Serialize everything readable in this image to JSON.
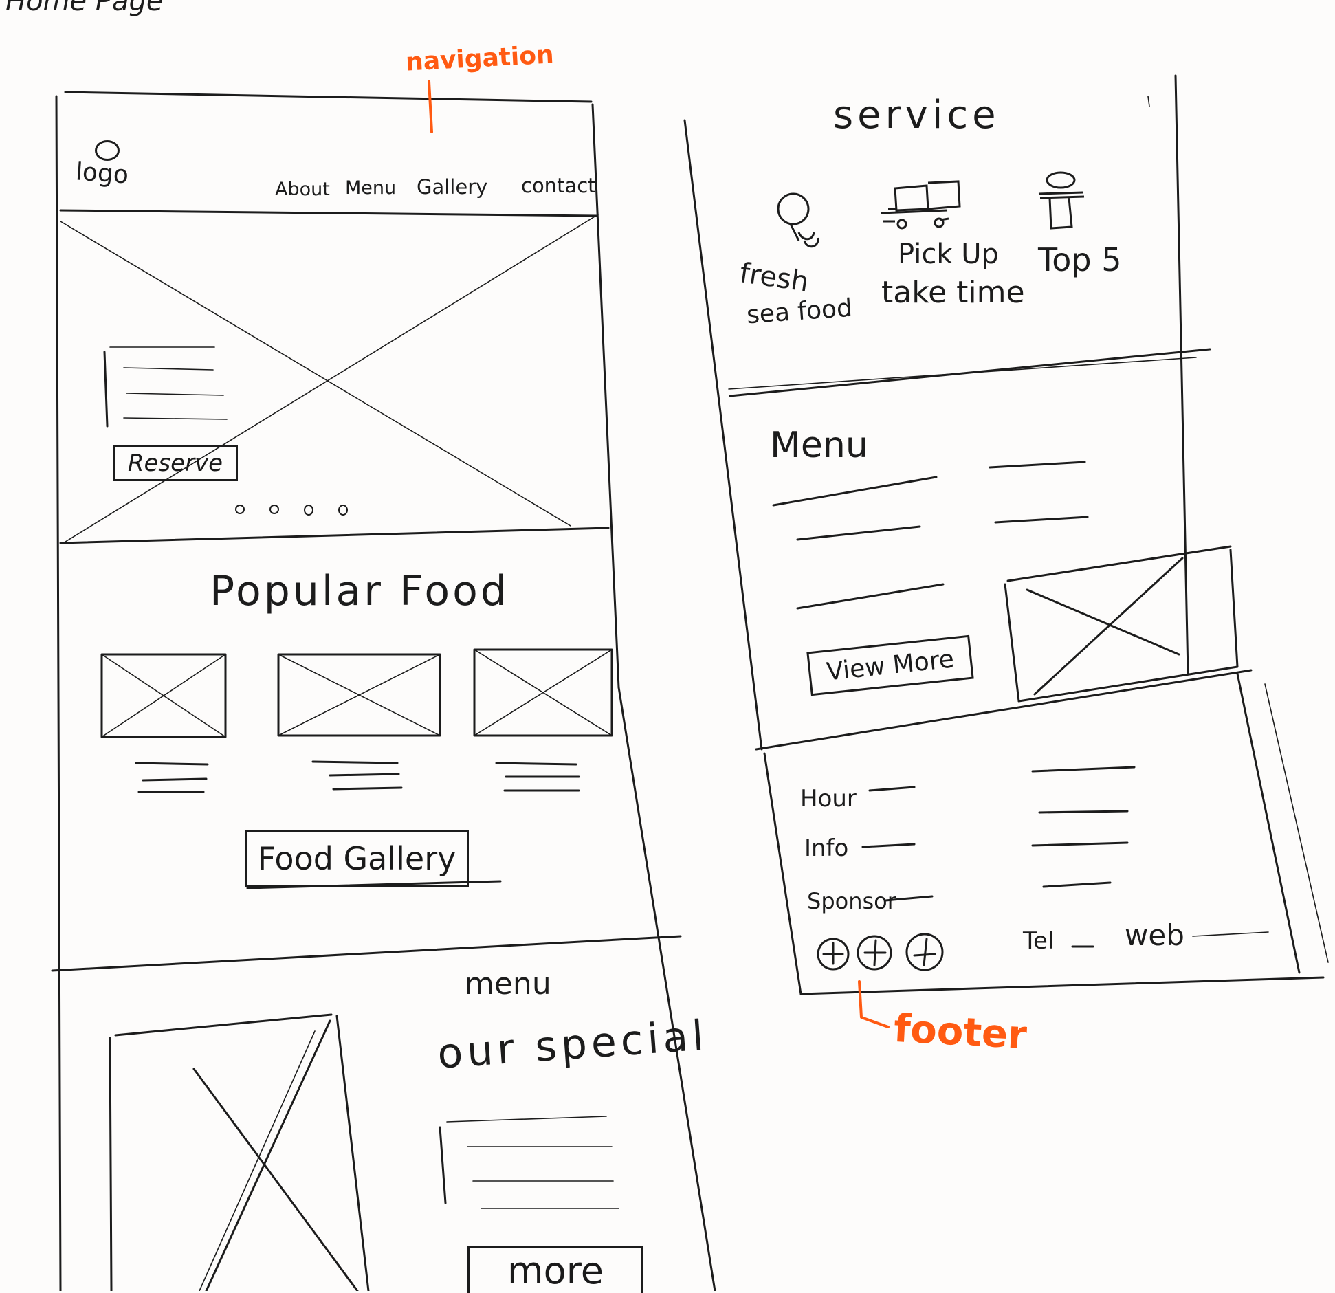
{
  "page_label": "Home Page",
  "annotations": {
    "navigation": "navigation",
    "footer": "footer"
  },
  "header": {
    "logo": "logo",
    "nav": [
      "About",
      "Menu",
      "Gallery",
      "contact"
    ]
  },
  "hero": {
    "reserve_label": "Reserve",
    "carousel_dots": 4
  },
  "popular": {
    "title": "Popular Food",
    "button_label": "Food Gallery"
  },
  "menu_special": {
    "kicker": "menu",
    "title": "our special",
    "more_label": "more"
  },
  "service": {
    "title": "service",
    "items": [
      {
        "label_line1": "fresh",
        "label_line2": "sea food",
        "icon": "seafood-icon"
      },
      {
        "label_line1": "Pick Up",
        "label_line2": "take time",
        "icon": "truck-icon"
      },
      {
        "label_line1": "Top 5",
        "label_line2": "",
        "icon": "trophy-icon"
      }
    ]
  },
  "menu_section": {
    "title": "Menu",
    "button_label": "View More"
  },
  "footer": {
    "rows": [
      "Hour",
      "Info",
      "Sponsor"
    ],
    "tel": "Tel",
    "web": "web",
    "social_icons": [
      "social-icon-1",
      "social-icon-2",
      "social-icon-3"
    ]
  }
}
